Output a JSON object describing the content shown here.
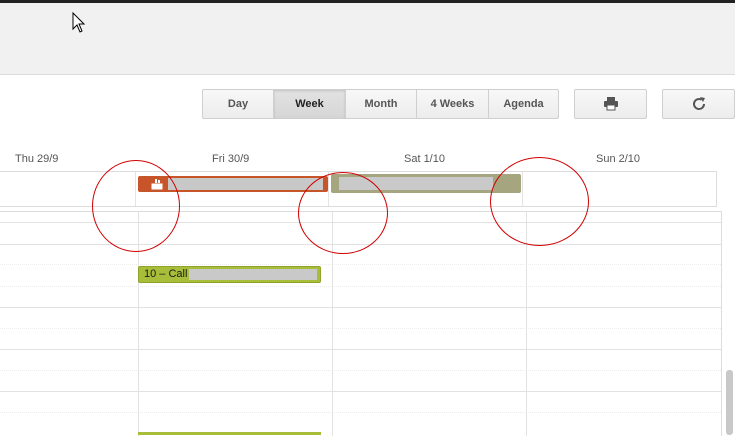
{
  "view_buttons": {
    "day": "Day",
    "week": "Week",
    "month": "Month",
    "four_weeks": "4 Weeks",
    "agenda": "Agenda",
    "active": "Week"
  },
  "toolbar_icons": {
    "print": "print-icon",
    "refresh": "refresh-icon"
  },
  "days": {
    "thu": "Thu 29/9",
    "fri": "Fri 30/9",
    "sat": "Sat 1/10",
    "sun": "Sun 2/10"
  },
  "events": {
    "call_label": "10 – Call",
    "birthday_icon": "cake-icon"
  },
  "colors": {
    "orange_event": "#c8552a",
    "olive_event": "#a5a580",
    "green_event": "#a8bd3a",
    "annotation_circle": "#d00000"
  }
}
